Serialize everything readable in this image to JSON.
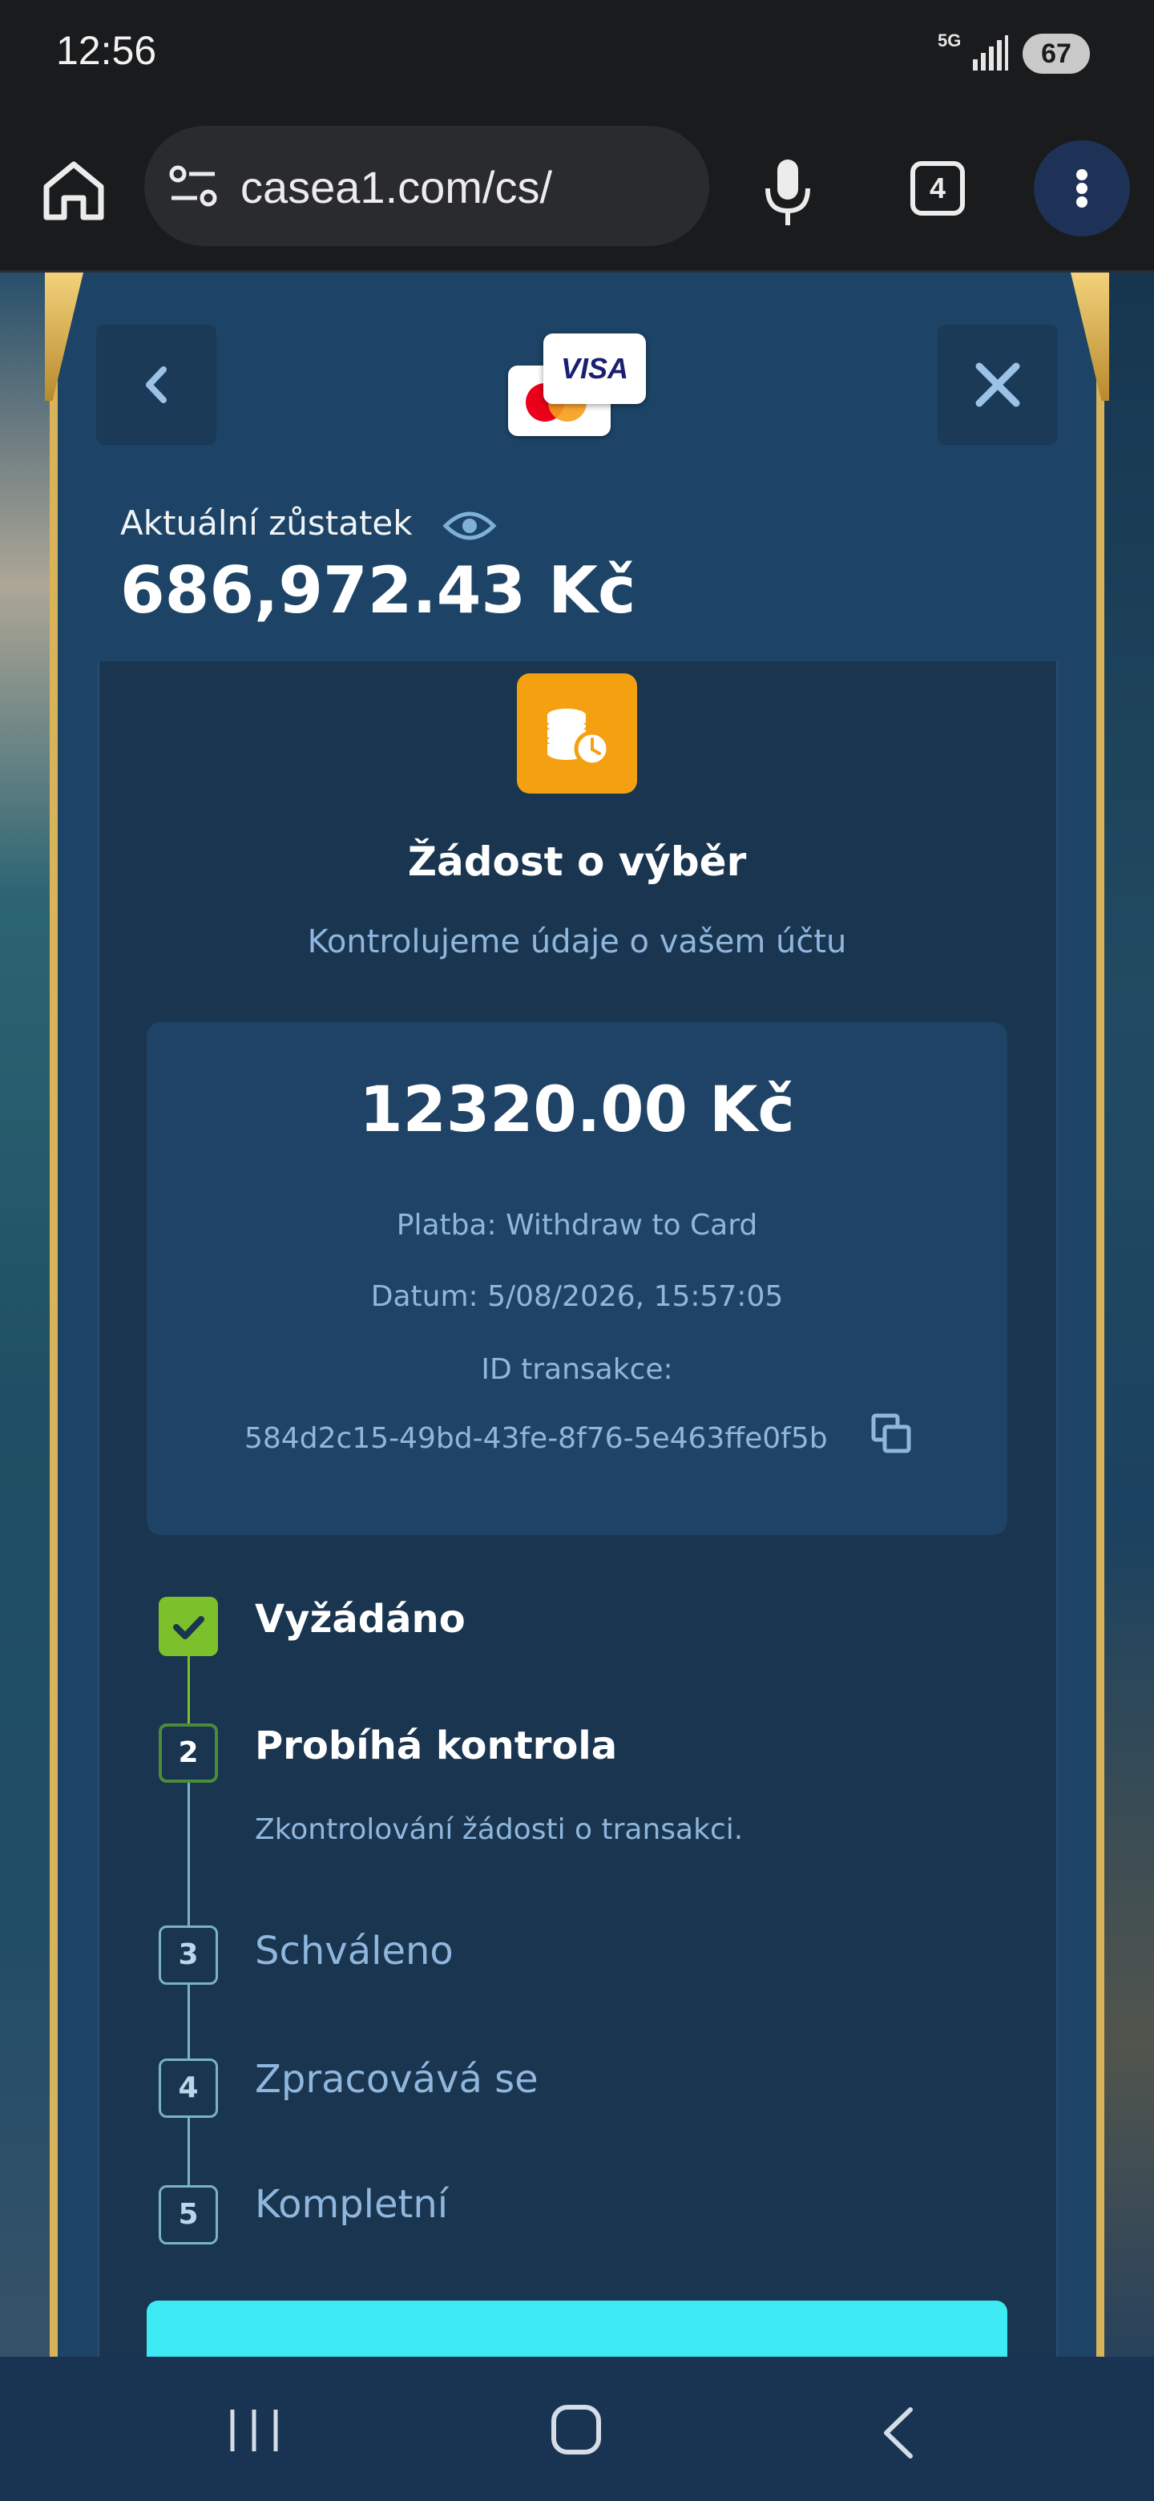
{
  "status_bar": {
    "time": "12:56",
    "network": "5G",
    "battery": "67"
  },
  "browser": {
    "url": "casea1.com/cs/",
    "tab_count": "4"
  },
  "modal": {
    "payment_logos": {
      "visa": "VISA",
      "mastercard": "mastercard-logo"
    },
    "balance_label": "Aktuální zůstatek",
    "balance_value": "686,972.43 Kč",
    "title": "Žádost o výběr",
    "subtitle": "Kontrolujeme údaje o vašem účtu",
    "summary": {
      "amount": "12320.00 Kč",
      "payment": "Platba: Withdraw to Card",
      "date": "Datum: 5/08/2026, 15:57:05",
      "tx_label": "ID transakce:",
      "tx_id": "584d2c15-49bd-43fe-8f76-5e463ffe0f5b"
    },
    "steps": [
      {
        "number": "1",
        "label": "Vyžádáno",
        "state": "done"
      },
      {
        "number": "2",
        "label": "Probíhá kontrola",
        "state": "active",
        "description": "Zkontrolování žádosti o transakci."
      },
      {
        "number": "3",
        "label": "Schváleno",
        "state": "pending"
      },
      {
        "number": "4",
        "label": "Zpracovává se",
        "state": "pending"
      },
      {
        "number": "5",
        "label": "Kompletní",
        "state": "pending"
      }
    ]
  },
  "colors": {
    "modal_bg": "#1d4466",
    "gold_frame": "#d9b35a",
    "accent_orange": "#f5a011",
    "success_green": "#7cc02c",
    "muted_text": "#8fb7dd",
    "cta_cyan": "#3de9f2"
  }
}
